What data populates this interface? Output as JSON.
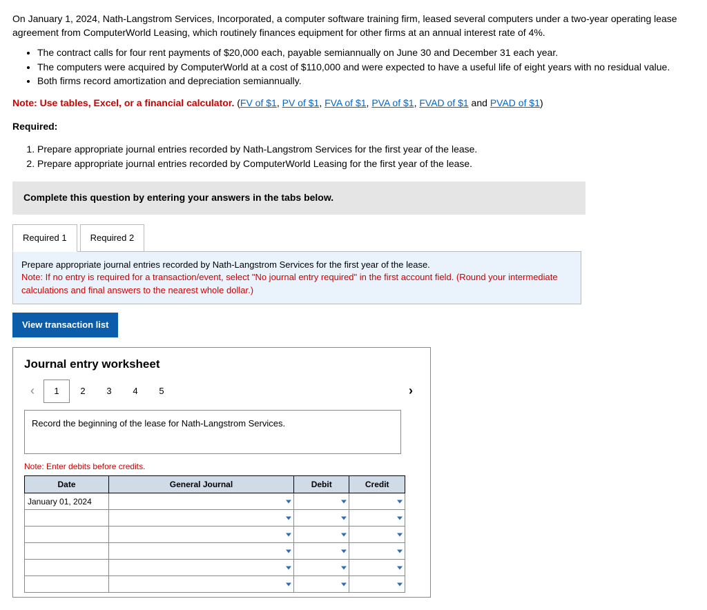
{
  "problem": {
    "intro": "On January 1, 2024, Nath-Langstrom Services, Incorporated, a computer software training firm, leased several computers under a two-year operating lease agreement from ComputerWorld Leasing, which routinely finances equipment for other firms at an annual interest rate of 4%.",
    "bullets": [
      "The contract calls for four rent payments of $20,000 each, payable semiannually on June 30 and December 31 each year.",
      "The computers were acquired by ComputerWorld at a cost of $110,000 and were expected to have a useful life of eight years with no residual value.",
      "Both firms record amortization and depreciation semiannually."
    ],
    "note_prefix": "Note: Use tables, Excel, or a financial calculator. ",
    "links": [
      "FV of $1",
      "PV of $1",
      "FVA of $1",
      "PVA of $1",
      "FVAD of $1",
      "PVAD of $1"
    ],
    "and_word": " and ",
    "close_paren": ")",
    "open_paren": "(",
    "sep": ", ",
    "required_label": "Required:",
    "reqs": [
      "Prepare appropriate journal entries recorded by Nath-Langstrom Services for the first year of the lease.",
      "Prepare appropriate journal entries recorded by ComputerWorld Leasing for the first year of the lease."
    ]
  },
  "banner": "Complete this question by entering your answers in the tabs below.",
  "tabs": {
    "t1": "Required 1",
    "t2": "Required 2"
  },
  "instruction": {
    "main": "Prepare appropriate journal entries recorded by Nath-Langstrom Services for the first year of the lease.",
    "note": "Note: If no entry is required for a transaction/event, select \"No journal entry required\" in the first account field. (Round your intermediate calculations and final answers to the nearest whole dollar.)"
  },
  "view_btn": "View transaction list",
  "worksheet": {
    "title": "Journal entry worksheet",
    "steps": [
      "1",
      "2",
      "3",
      "4",
      "5"
    ],
    "record_prompt": "Record the beginning of the lease for Nath-Langstrom Services.",
    "credit_note": "Note: Enter debits before credits.",
    "headers": {
      "date": "Date",
      "gj": "General Journal",
      "debit": "Debit",
      "credit": "Credit"
    },
    "first_date": "January 01, 2024"
  }
}
